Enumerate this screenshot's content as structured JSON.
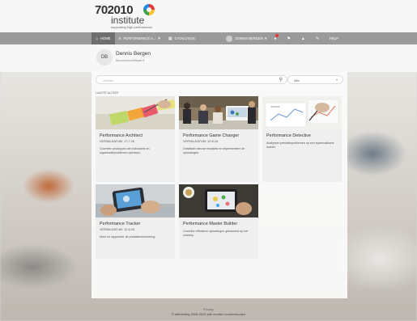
{
  "brand": {
    "numbers": "702010",
    "word": "institute",
    "tagline": "supporting high performance"
  },
  "nav": {
    "home": "HOME",
    "performance": "PERFORMANCE A...",
    "catalogus": "CATALOGUS",
    "user": "DENNIS BERGEN",
    "help": "HELP"
  },
  "profile": {
    "initials": "DB",
    "name": "Dennis Bergen",
    "subtitle": "Bezoekerscertificaat ▾"
  },
  "search": {
    "placeholder": "Zoeken"
  },
  "filter": {
    "value": "Alle"
  },
  "section_label": "LAATST ACTIEF:",
  "cards": [
    {
      "title": "Performance Architect",
      "date": "VERVALDATUM: 17-7-16",
      "desc": "Cocreëer prototypen die individuele en organisatieproblemen oplossen."
    },
    {
      "title": "Performance Game Changer",
      "date": "VERVALDATUM: 12-8-16",
      "desc": "Ontwikkel nieuwe mindsets en implementeer de oplossingen."
    },
    {
      "title": "Performance Detective",
      "date": "",
      "desc": "Analyseer prestatieproblemen op een systematische manier."
    },
    {
      "title": "Performance Tracker",
      "date": "VERVALDATUM: 12-8-16",
      "desc": "Meet en rapporteer de prestatieverbetering."
    },
    {
      "title": "Performance Master Builder",
      "date": "",
      "desc": "Cocreëer effectieve oplossingen gebaseerd op het ontwerp."
    }
  ],
  "footer": {
    "privacy": "Privacy",
    "copyright": "© afbeelding 2008-2015 alle rechten voorbehouden"
  },
  "colors": {
    "navbar": "#9a9a9a",
    "nav_active": "#6f6f6f",
    "badge": "#e53935"
  }
}
